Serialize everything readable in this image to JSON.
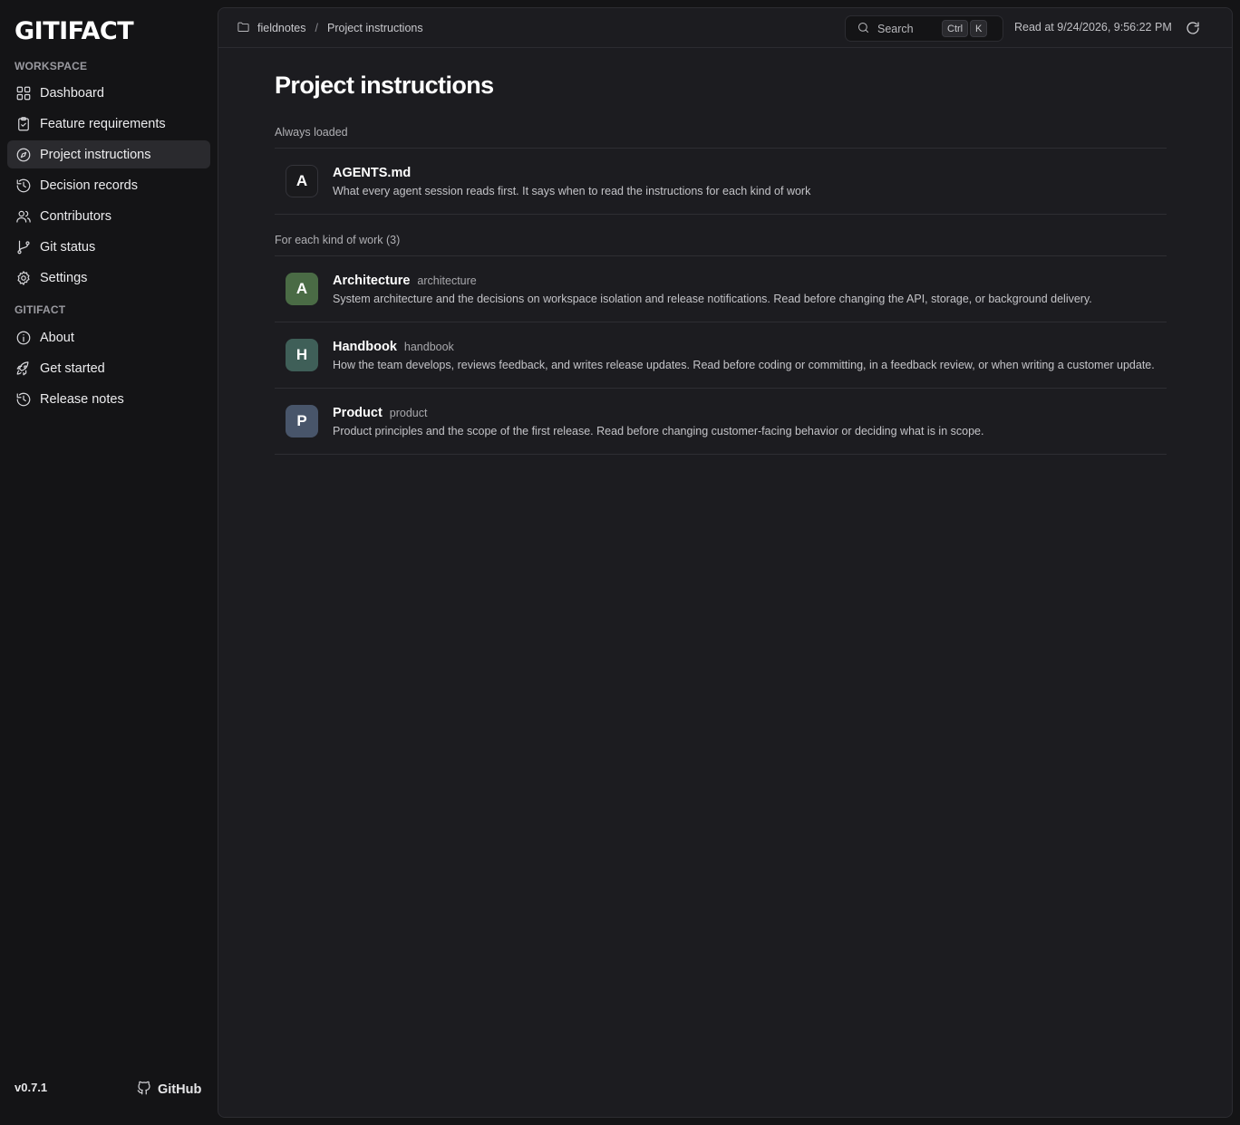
{
  "app": {
    "logo": "GITIFACT",
    "version": "v0.7.1",
    "github_label": "GitHub"
  },
  "sidebar": {
    "workspace_label": "WORKSPACE",
    "workspace_items": [
      {
        "label": "Dashboard",
        "icon": "dashboard-icon"
      },
      {
        "label": "Feature requirements",
        "icon": "clipboard-icon"
      },
      {
        "label": "Project instructions",
        "icon": "compass-icon",
        "active": true
      },
      {
        "label": "Decision records",
        "icon": "history-icon"
      },
      {
        "label": "Contributors",
        "icon": "users-icon"
      },
      {
        "label": "Git status",
        "icon": "git-branch-icon"
      },
      {
        "label": "Settings",
        "icon": "gear-icon"
      }
    ],
    "gitifact_label": "GITIFACT",
    "gitifact_items": [
      {
        "label": "About",
        "icon": "info-icon"
      },
      {
        "label": "Get started",
        "icon": "rocket-icon"
      },
      {
        "label": "Release notes",
        "icon": "history-icon"
      }
    ]
  },
  "topbar": {
    "breadcrumb": [
      "fieldnotes",
      "Project instructions"
    ],
    "search_placeholder": "Search",
    "shortcut": [
      "Ctrl",
      "K"
    ],
    "read_at": "Read at 9/24/2026, 9:56:22 PM"
  },
  "page": {
    "title": "Project instructions",
    "always_loaded_label": "Always loaded",
    "always_loaded": {
      "letter": "A",
      "name": "AGENTS.md",
      "description": "What every agent session reads first. It says when to read the instructions for each kind of work"
    },
    "per_work_label": "For each kind of work (3)",
    "instructions": [
      {
        "letter": "A",
        "color": "#4a6b45",
        "name": "Architecture",
        "slug": "architecture",
        "description": "System architecture and the decisions on workspace isolation and release notifications. Read before changing the API, storage, or background delivery."
      },
      {
        "letter": "H",
        "color": "#3f5f58",
        "name": "Handbook",
        "slug": "handbook",
        "description": "How the team develops, reviews feedback, and writes release updates. Read before coding or committing, in a feedback review, or when writing a customer update."
      },
      {
        "letter": "P",
        "color": "#48556a",
        "name": "Product",
        "slug": "product",
        "description": "Product principles and the scope of the first release. Read before changing customer-facing behavior or deciding what is in scope."
      }
    ]
  }
}
